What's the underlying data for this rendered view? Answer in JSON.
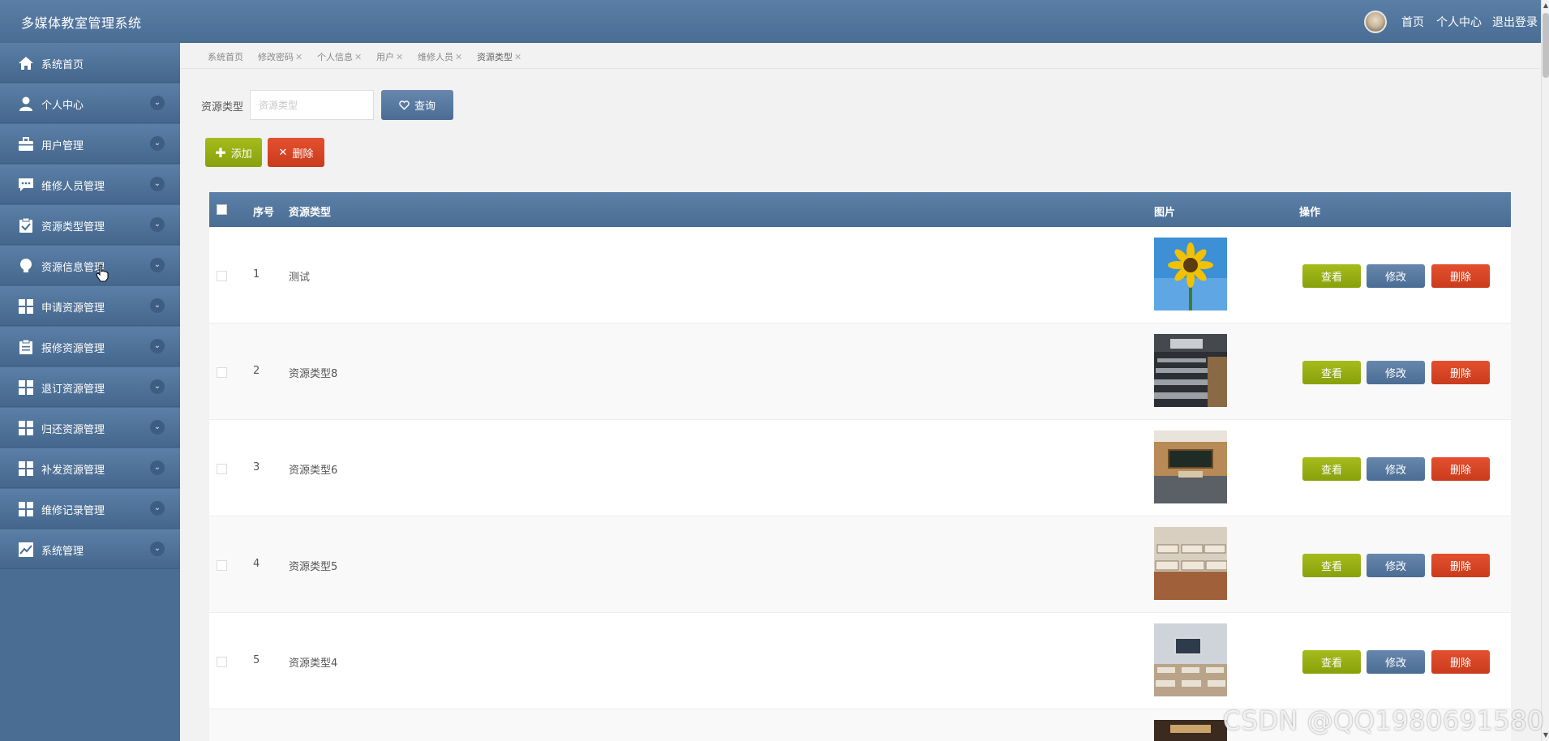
{
  "app": {
    "title": "多媒体教室管理系统"
  },
  "header": {
    "nav": [
      "首页",
      "个人中心",
      "退出登录"
    ]
  },
  "sidebar": {
    "items": [
      {
        "label": "系统首页",
        "icon": "home-icon",
        "expandable": false
      },
      {
        "label": "个人中心",
        "icon": "user-icon",
        "expandable": true
      },
      {
        "label": "用户管理",
        "icon": "briefcase-icon",
        "expandable": true
      },
      {
        "label": "维修人员管理",
        "icon": "chat-icon",
        "expandable": true
      },
      {
        "label": "资源类型管理",
        "icon": "clipboard-check-icon",
        "expandable": true
      },
      {
        "label": "资源信息管理",
        "icon": "lightbulb-icon",
        "expandable": true
      },
      {
        "label": "申请资源管理",
        "icon": "grid-icon",
        "expandable": true
      },
      {
        "label": "报修资源管理",
        "icon": "clipboard-icon",
        "expandable": true
      },
      {
        "label": "退订资源管理",
        "icon": "grid-icon",
        "expandable": true
      },
      {
        "label": "归还资源管理",
        "icon": "grid-icon",
        "expandable": true
      },
      {
        "label": "补发资源管理",
        "icon": "grid-icon",
        "expandable": true
      },
      {
        "label": "维修记录管理",
        "icon": "grid-icon",
        "expandable": true
      },
      {
        "label": "系统管理",
        "icon": "chart-icon",
        "expandable": true
      }
    ]
  },
  "tabs": [
    {
      "label": "系统首页",
      "closable": false
    },
    {
      "label": "修改密码",
      "closable": true
    },
    {
      "label": "个人信息",
      "closable": true
    },
    {
      "label": "用户",
      "closable": true
    },
    {
      "label": "维修人员",
      "closable": true
    },
    {
      "label": "资源类型",
      "closable": true,
      "active": true
    }
  ],
  "search": {
    "label": "资源类型",
    "placeholder": "资源类型",
    "value": "",
    "button_label": "查询"
  },
  "actions": {
    "add_label": "添加",
    "delete_label": "删除"
  },
  "table": {
    "headers": {
      "index": "序号",
      "type": "资源类型",
      "image": "图片",
      "ops": "操作"
    },
    "row_actions": {
      "view": "查看",
      "edit": "修改",
      "delete": "删除"
    },
    "rows": [
      {
        "index": "1",
        "type": "测试",
        "image": "sunflower"
      },
      {
        "index": "2",
        "type": "资源类型8",
        "image": "lecture-hall"
      },
      {
        "index": "3",
        "type": "资源类型6",
        "image": "classroom-blackboard"
      },
      {
        "index": "4",
        "type": "资源类型5",
        "image": "classroom-desks"
      },
      {
        "index": "5",
        "type": "资源类型4",
        "image": "multimedia-classroom"
      }
    ]
  },
  "watermark": "CSDN @QQ1980691580",
  "colors": {
    "primary": "#4a6d94",
    "success": "#94ab12",
    "danger": "#d4431f"
  }
}
